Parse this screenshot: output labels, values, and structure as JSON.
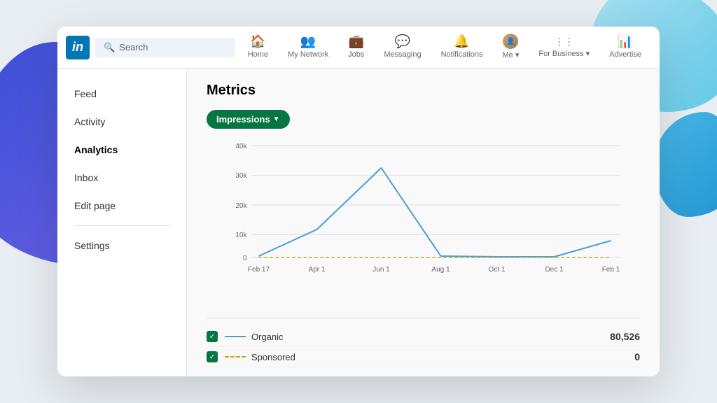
{
  "background": {
    "blobLeft": "decorative-left-blob",
    "blobRightTop": "decorative-right-top-blob",
    "blobRightBottom": "decorative-right-bottom-blob"
  },
  "navbar": {
    "logo_text": "in",
    "search_placeholder": "Search",
    "items": [
      {
        "id": "home",
        "label": "Home",
        "icon": "🏠"
      },
      {
        "id": "my-network",
        "label": "My Network",
        "icon": "👥"
      },
      {
        "id": "jobs",
        "label": "Jobs",
        "icon": "💼"
      },
      {
        "id": "messaging",
        "label": "Messaging",
        "icon": "💬"
      },
      {
        "id": "notifications",
        "label": "Notifications",
        "icon": "🔔"
      },
      {
        "id": "me",
        "label": "Me ▾",
        "icon": "avatar"
      },
      {
        "id": "for-business",
        "label": "For Business ▾",
        "icon": "⋮⋮⋮"
      },
      {
        "id": "advertise",
        "label": "Advertise",
        "icon": "📊"
      }
    ]
  },
  "sidebar": {
    "items": [
      {
        "id": "feed",
        "label": "Feed",
        "active": false
      },
      {
        "id": "activity",
        "label": "Activity",
        "active": false
      },
      {
        "id": "analytics",
        "label": "Analytics",
        "active": true
      },
      {
        "id": "inbox",
        "label": "Inbox",
        "active": false
      },
      {
        "id": "edit-page",
        "label": "Edit page",
        "active": false
      },
      {
        "id": "settings",
        "label": "Settings",
        "active": false
      }
    ]
  },
  "analytics": {
    "title": "Metrics",
    "filter_label": "Impressions",
    "chart": {
      "x_labels": [
        "Feb 17",
        "Apr 1",
        "Jun 1",
        "Aug 1",
        "Oct 1",
        "Dec 1",
        "Feb 1"
      ],
      "y_labels": [
        "40k",
        "30k",
        "20k",
        "10k",
        "0"
      ],
      "y_max": 40000,
      "organic_data": [
        500,
        10000,
        32000,
        500,
        200,
        200,
        6000
      ],
      "sponsored_data": [
        0,
        0,
        0,
        0,
        0,
        0,
        0
      ]
    },
    "legend": [
      {
        "id": "organic",
        "label": "Organic",
        "type": "solid",
        "value": "80,526",
        "checked": true
      },
      {
        "id": "sponsored",
        "label": "Sponsored",
        "type": "dashed",
        "value": "0",
        "checked": true
      }
    ]
  }
}
